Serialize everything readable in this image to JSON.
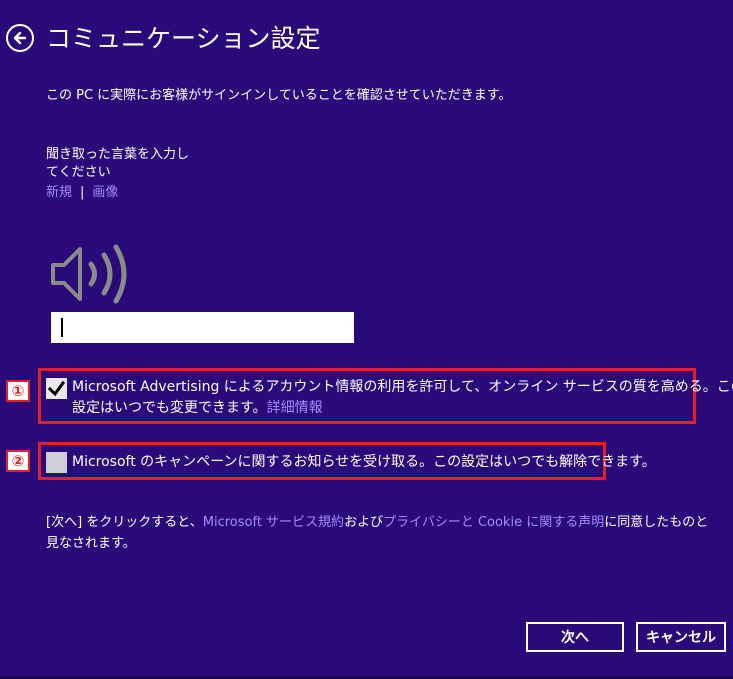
{
  "header": {
    "title": "コミュニケーション設定"
  },
  "intro_text": "この PC に実際にお客様がサインインしていることを確認させていただきます。",
  "captcha": {
    "prompt_line1": "聞き取った言葉を入力し",
    "prompt_line2": "てください",
    "new_link": "新規",
    "separator": "|",
    "image_link": "画像",
    "input_value": "",
    "speaker_icon": "speaker-icon"
  },
  "options": [
    {
      "badge": "①",
      "checked": true,
      "text_line1": "Microsoft Advertising によるアカウント情報の利用を許可して、オンライン サービスの質を高める。この",
      "text_line2": "設定はいつでも変更できます。",
      "link": "詳細情報"
    },
    {
      "badge": "②",
      "checked": false,
      "text": "Microsoft のキャンペーンに関するお知らせを受け取る。この設定はいつでも解除できます。"
    }
  ],
  "terms": {
    "part1": "[次へ] をクリックすると、",
    "link1": "Microsoft サービス規約",
    "part2": "および",
    "link2": "プライバシーと Cookie に関する声明",
    "part3": "に同意したものと",
    "line2": "見なされます。"
  },
  "buttons": {
    "next": "次へ",
    "cancel": "キャンセル"
  },
  "colors": {
    "background": "#2a0a78",
    "link": "#a48cff",
    "highlight_box": "#e21f2a"
  }
}
